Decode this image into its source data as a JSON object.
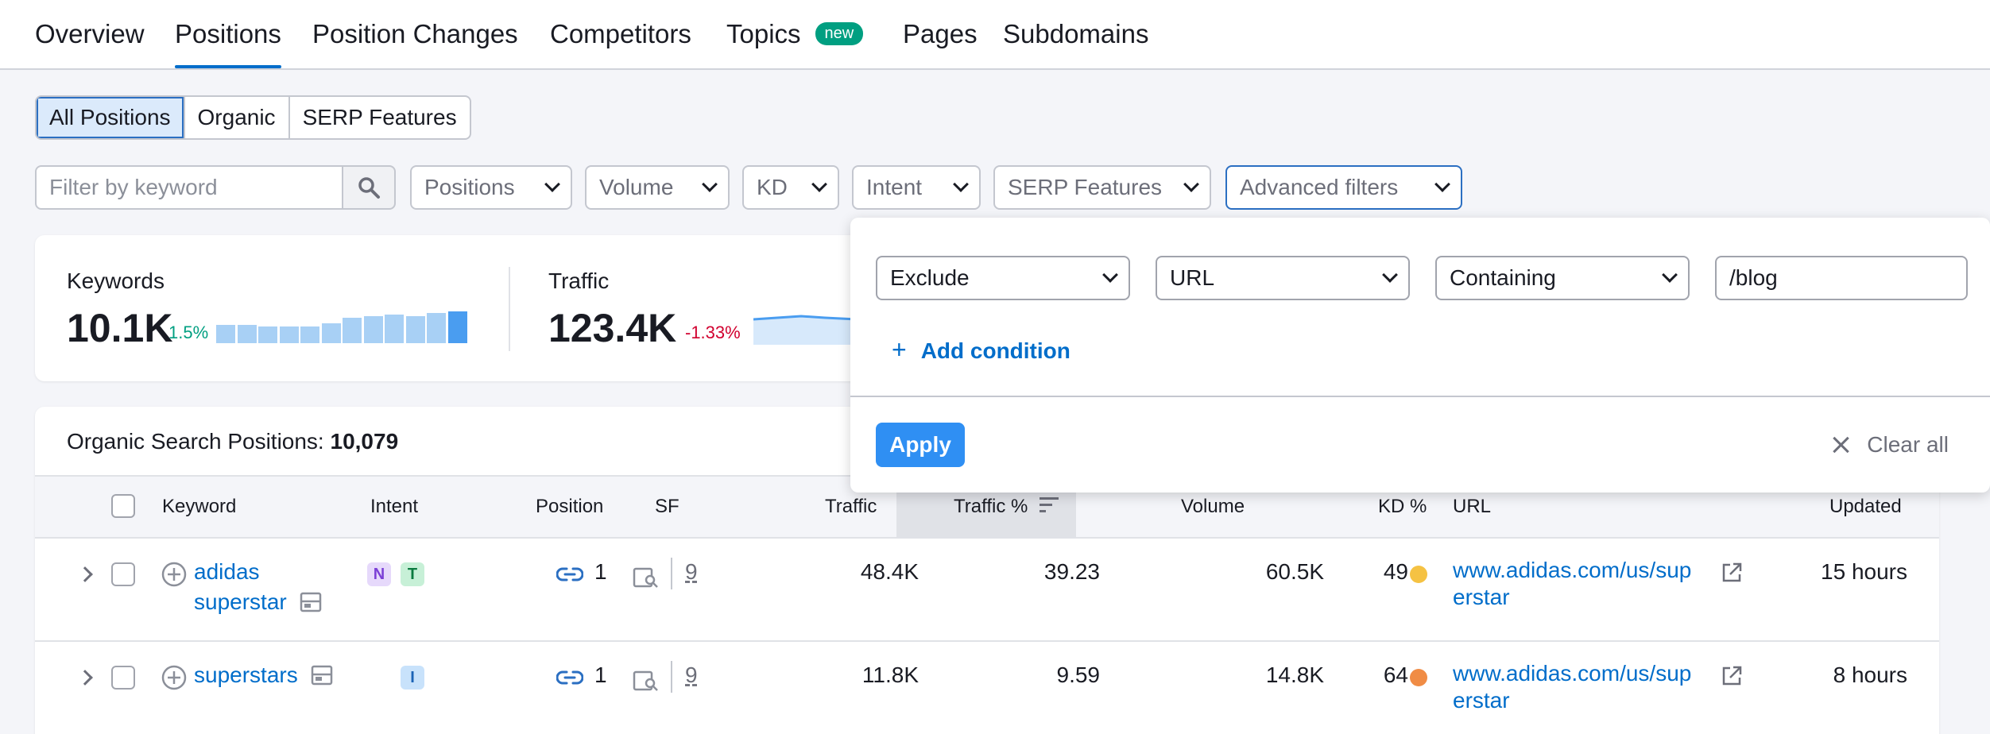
{
  "tabs": [
    {
      "label": "Overview"
    },
    {
      "label": "Positions"
    },
    {
      "label": "Position Changes"
    },
    {
      "label": "Competitors"
    },
    {
      "label": "Topics",
      "badge": "new"
    },
    {
      "label": "Pages"
    },
    {
      "label": "Subdomains"
    }
  ],
  "segments": [
    "All Positions",
    "Organic",
    "SERP Features"
  ],
  "filters": {
    "keyword_placeholder": "Filter by keyword",
    "dropdowns": [
      "Positions",
      "Volume",
      "KD",
      "Intent",
      "SERP Features",
      "Advanced filters"
    ]
  },
  "summary": {
    "keywords": {
      "label": "Keywords",
      "value": "10.1K",
      "change": "1.5%",
      "trend": [
        0.55,
        0.55,
        0.5,
        0.5,
        0.5,
        0.6,
        0.75,
        0.8,
        0.85,
        0.8,
        0.9,
        0.95
      ]
    },
    "traffic": {
      "label": "Traffic",
      "value": "123.4K",
      "change": "-1.33%"
    }
  },
  "colors": {
    "accent": "#006dca",
    "positive": "#009f81",
    "negative": "#d1002f",
    "kd_medium": "#f5c243",
    "kd_high": "#f08c45"
  },
  "table": {
    "title_label": "Organic Search Positions:",
    "title_count": "10,079",
    "columns": [
      "Keyword",
      "Intent",
      "Position",
      "SF",
      "Traffic",
      "Traffic %",
      "Volume",
      "KD %",
      "URL",
      "Updated"
    ],
    "rows": [
      {
        "keyword_line1": "adidas",
        "keyword_line2": "superstar",
        "intents": [
          "N",
          "T"
        ],
        "position": "1",
        "sf": "9",
        "traffic": "48.4K",
        "traffic_pct": "39.23",
        "volume": "60.5K",
        "kd": "49",
        "kd_color": "#f5c243",
        "url_line1": "www.adidas.com/us/sup",
        "url_line2": "erstar",
        "updated": "15 hours"
      },
      {
        "keyword_line1": "superstars",
        "keyword_line2": "",
        "intents": [
          "I"
        ],
        "position": "1",
        "sf": "9",
        "traffic": "11.8K",
        "traffic_pct": "9.59",
        "volume": "14.8K",
        "kd": "64",
        "kd_color": "#f08c45",
        "url_line1": "www.adidas.com/us/sup",
        "url_line2": "erstar",
        "updated": "8 hours"
      }
    ]
  },
  "advanced_popup": {
    "condition_type": "Exclude",
    "field": "URL",
    "operator": "Containing",
    "value": "/blog",
    "add_condition_label": "Add condition",
    "apply_label": "Apply",
    "clear_label": "Clear all"
  }
}
